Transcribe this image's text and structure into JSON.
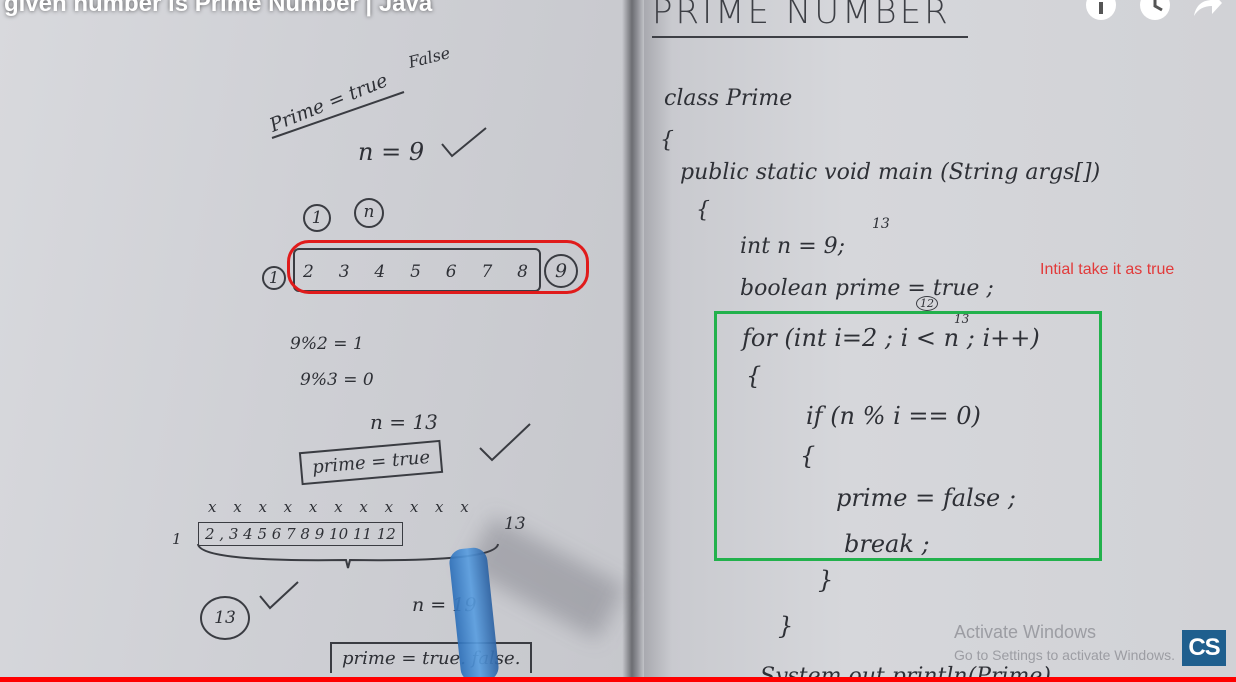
{
  "video": {
    "title": "given number is Prime Number | Java",
    "icons": [
      "info-icon",
      "clock-icon",
      "share-icon"
    ]
  },
  "left_page": {
    "prime_flag": "Prime = true",
    "false_word": "False",
    "n9": "n = 9",
    "circle_1": "1",
    "circle_n": "n",
    "left_one": "1",
    "range_numbers": [
      "2",
      "3",
      "4",
      "5",
      "6",
      "7",
      "8"
    ],
    "circled_nine": "9",
    "mod1": "9%2 = 1",
    "mod2": "9%3 = 0",
    "n13": "n = 13",
    "boxed_prime": "prime = true",
    "crosses": "x x x x x x x x x x x",
    "one_again": "1",
    "range2": "2 , 3  4  5  6  7  8  9 10  11 12",
    "thirteen": "13",
    "circled_13": "13",
    "n19": "n = 19",
    "prime_false": "prime = true. false."
  },
  "right_page": {
    "heading": "PRIME NUMBER",
    "code": [
      "class Prime",
      "{",
      "public static void main (String args[])",
      "{",
      "int n = 9;",
      "boolean prime = true ;",
      "for (int i=2 ; i < n ; i++)",
      "{",
      "if (n % i == 0)",
      "{",
      "prime = false ;",
      "break ;",
      "}",
      "}",
      "System.out.println(Prime)"
    ],
    "sup13_a": "13",
    "sup12": "12",
    "sup13_b": "13",
    "annotation": "Intial take it as true"
  },
  "overlay": {
    "activate_title": "Activate Windows",
    "activate_sub": "Go to Settings to activate Windows.",
    "logo": "CS"
  },
  "colors": {
    "annotation": "#e23a3a",
    "green_box": "#22b14c",
    "red_oval": "#e01b1b",
    "progress": "#ff0000"
  }
}
